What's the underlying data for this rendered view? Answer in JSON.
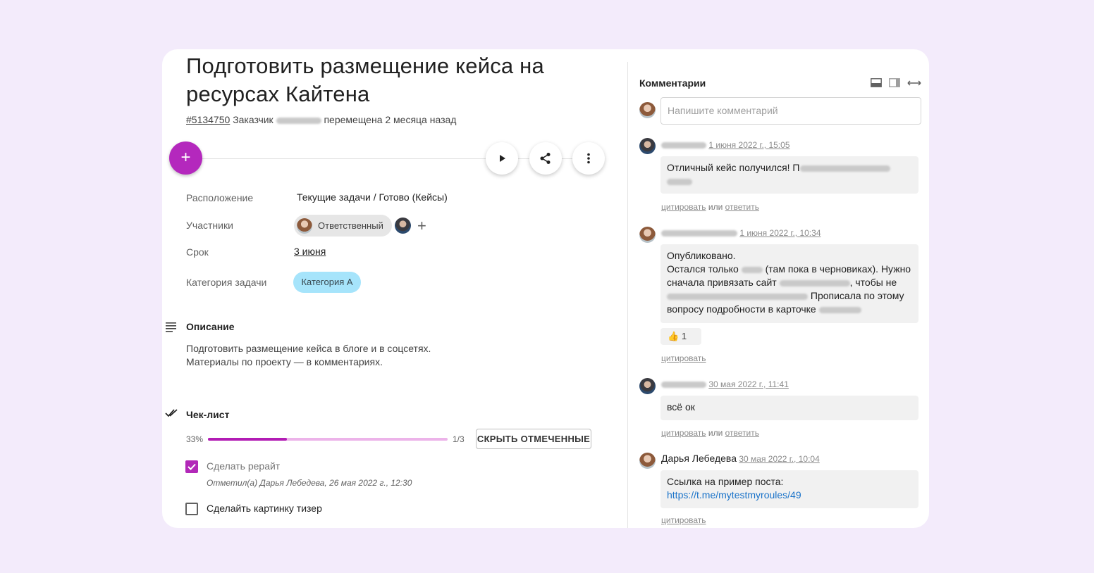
{
  "task": {
    "title": "Подготовить размещение кейса на ресурсах Кайтена",
    "id": "#5134750",
    "customer_label": "Заказчик",
    "moved": "перемещена 2 месяца назад"
  },
  "properties": {
    "location_label": "Расположение",
    "location_value": "Текущие задачи / Готово (Кейсы)",
    "members_label": "Участники",
    "responsible_chip": "Ответственный",
    "deadline_label": "Срок",
    "deadline_value": "3 июня",
    "category_label": "Категория задачи",
    "category_value": "Категория А"
  },
  "description": {
    "title": "Описание",
    "line1": "Подготовить размещение кейса в блоге и в соцсетях.",
    "line2": "Материалы по проекту — в комментариях."
  },
  "checklist": {
    "title": "Чек-лист",
    "percent": "33%",
    "progress": 0.33,
    "fraction": "1/3",
    "hide_button": "СКРЫТЬ ОТМЕЧЕННЫЕ",
    "items": [
      {
        "text": "Сделать рерайт",
        "checked": true,
        "note": "Отметил(а) Дарья Лебедева, 26 мая 2022 г., 12:30"
      },
      {
        "text": "Сделайть картинку тизер",
        "checked": false
      }
    ]
  },
  "comments": {
    "title": "Комментарии",
    "placeholder": "Напишите комментарий",
    "quote": "цитировать",
    "or": "или",
    "reply": "ответить",
    "list": [
      {
        "date": "1 июня 2022 г., 15:05",
        "text": "Отличный кейс получился! П"
      },
      {
        "date": "1 июня 2022 г., 10:34",
        "l1": "Опубликовано.",
        "l2a": "Остался только",
        "l2b": "(там пока в черновиках). Нужно",
        "l3a": "сначала привязать сайт",
        "l3b": ", чтобы не",
        "l4": "Прописала по этому",
        "l5": "вопросу подробности в карточке",
        "reaction": "1"
      },
      {
        "date": "30 мая 2022 г., 11:41",
        "text": "всё ок"
      },
      {
        "name": "Дарья Лебедева",
        "date": "30 мая 2022 г., 10:04",
        "text": "Ссылка на пример поста:",
        "link": "https://t.me/mytestmyroules/49"
      }
    ]
  },
  "colors": {
    "accent": "#b428bd",
    "category_chip": "#a6e4fb",
    "background": "#f3ebfb"
  }
}
